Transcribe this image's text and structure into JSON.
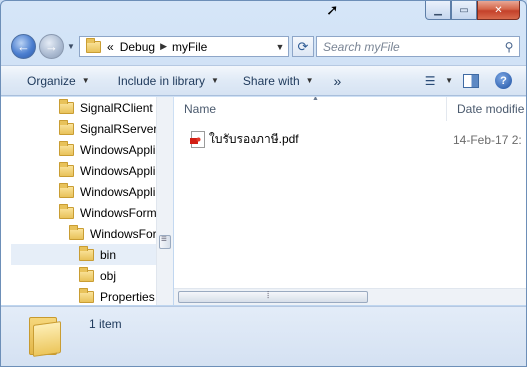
{
  "address": {
    "overflow": "«",
    "crumbs": [
      "Debug",
      "myFile"
    ]
  },
  "search": {
    "placeholder": "Search myFile"
  },
  "toolbar": {
    "organize": "Organize",
    "include_in_library": "Include in library",
    "share_with": "Share with",
    "more": "»"
  },
  "tree": {
    "items": [
      {
        "label": "SignalRClient"
      },
      {
        "label": "SignalRServer"
      },
      {
        "label": "WindowsAppli"
      },
      {
        "label": "WindowsAppli"
      },
      {
        "label": "WindowsAppli"
      },
      {
        "label": "WindowsForm"
      },
      {
        "label": "WindowsFor"
      },
      {
        "label": "bin"
      },
      {
        "label": "obj"
      },
      {
        "label": "Properties"
      }
    ]
  },
  "columns": {
    "name": "Name",
    "date": "Date modifie"
  },
  "files": [
    {
      "name": "ใบรับรองภาษี.pdf",
      "date": "14-Feb-17 2:"
    }
  ],
  "status": {
    "item_count": "1 item"
  },
  "icons": {
    "back": "back-arrow-icon",
    "forward": "forward-arrow-icon",
    "refresh": "refresh-icon",
    "search": "search-icon",
    "help": "help-icon",
    "folder": "folder-icon",
    "pdf": "pdf-file-icon"
  }
}
